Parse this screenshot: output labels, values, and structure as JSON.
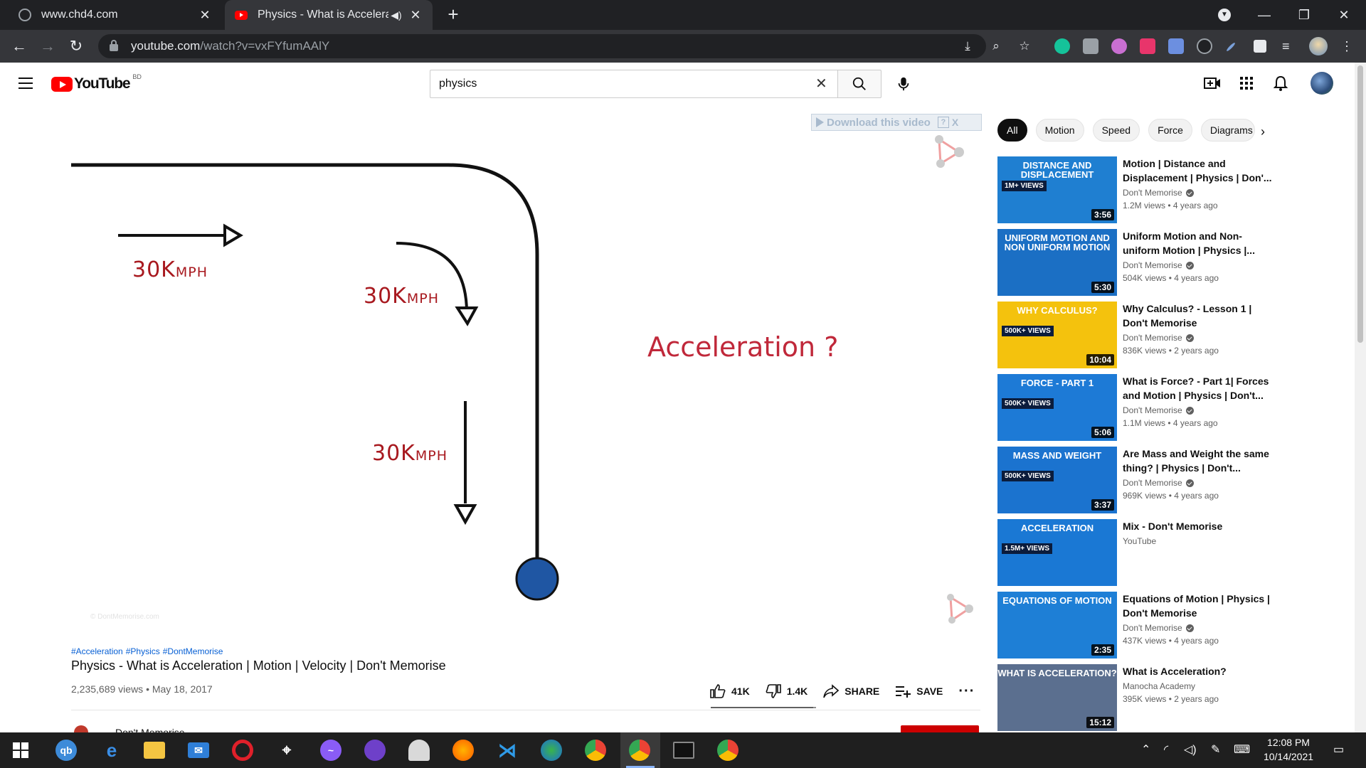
{
  "browser": {
    "tabs": [
      {
        "title": "www.chd4.com",
        "active": false
      },
      {
        "title": "Physics - What is Acceleration",
        "active": true
      }
    ],
    "url_host": "youtube.com",
    "url_path": "/watch?v=vxFYfumAAlY"
  },
  "masthead": {
    "logo_text": "YouTube",
    "country_code": "BD",
    "search_value": "physics"
  },
  "video": {
    "frame": {
      "speed_labels": [
        {
          "number": "30K",
          "unit": "MPH"
        },
        {
          "number": "30K",
          "unit": "MPH"
        },
        {
          "number": "30K",
          "unit": "MPH"
        }
      ],
      "question": "Acceleration ?",
      "watermark": "© DontMemorise.com"
    },
    "download_banner": "Download this video",
    "download_help": "?",
    "download_close": "X",
    "hashtags": [
      "#Acceleration",
      "#Physics",
      "#DontMemorise"
    ],
    "title": "Physics - What is Acceleration | Motion | Velocity | Don't Memorise",
    "views_date": "2,235,689 views • May 18, 2017",
    "likes": "41K",
    "dislikes": "1.4K",
    "share_label": "SHARE",
    "save_label": "SAVE",
    "like_ratio": 0.97,
    "channel_peek": "Don't Memorise"
  },
  "chips": [
    "All",
    "Motion",
    "Speed",
    "Force",
    "Diagrams"
  ],
  "related": [
    {
      "thumb_text": "Distance and Displacement",
      "badge": "1M+ VIEWS",
      "duration": "3:56",
      "title": "Motion | Distance and Displacement | Physics | Don'...",
      "channel": "Don't Memorise",
      "verified": true,
      "stats": "1.2M views • 4 years ago",
      "color": "#1f7fd1"
    },
    {
      "thumb_text": "Uniform Motion and Non Uniform Motion",
      "badge": "",
      "duration": "5:30",
      "title": "Uniform Motion and Non-uniform Motion | Physics |...",
      "channel": "Don't Memorise",
      "verified": true,
      "stats": "504K views • 4 years ago",
      "color": "#1b6fc4"
    },
    {
      "thumb_text": "Why Calculus?",
      "badge": "500K+ VIEWS",
      "duration": "10:04",
      "title": "Why Calculus? - Lesson 1 | Don't Memorise",
      "channel": "Don't Memorise",
      "verified": true,
      "stats": "836K views • 2 years ago",
      "color": "#f4c20d"
    },
    {
      "thumb_text": "Force - Part 1",
      "badge": "500K+ VIEWS",
      "duration": "5:06",
      "title": "What is Force? - Part 1| Forces and Motion | Physics | Don't...",
      "channel": "Don't Memorise",
      "verified": true,
      "stats": "1.1M views • 4 years ago",
      "color": "#1d7ad6"
    },
    {
      "thumb_text": "Mass and Weight",
      "badge": "500K+ VIEWS",
      "duration": "3:37",
      "title": "Are Mass and Weight the same thing? | Physics | Don't...",
      "channel": "Don't Memorise",
      "verified": true,
      "stats": "969K views • 4 years ago",
      "color": "#1b73cf"
    },
    {
      "thumb_text": "Acceleration",
      "badge": "1.5M+ VIEWS",
      "duration": "",
      "title": "Mix - Don't Memorise",
      "channel": "YouTube",
      "verified": false,
      "stats": "",
      "color": "#1a78d4"
    },
    {
      "thumb_text": "Equations of Motion",
      "badge": "",
      "duration": "2:35",
      "title": "Equations of Motion | Physics | Don't Memorise",
      "channel": "Don't Memorise",
      "verified": true,
      "stats": "437K views • 4 years ago",
      "color": "#1e7fd6"
    },
    {
      "thumb_text": "What is ACCELERATION?",
      "badge": "",
      "duration": "15:12",
      "title": "What is Acceleration?",
      "channel": "Manocha Academy",
      "verified": false,
      "stats": "395K views • 2 years ago",
      "color": "#5b6f8f"
    }
  ],
  "taskbar": {
    "time": "12:08 PM",
    "date": "10/14/2021"
  },
  "colors": {
    "youtube_red": "#ff0000",
    "speed_label": "#a8191f",
    "question_label": "#c0283a",
    "ball": "#1f56a3",
    "link_blue": "#065fd4"
  }
}
